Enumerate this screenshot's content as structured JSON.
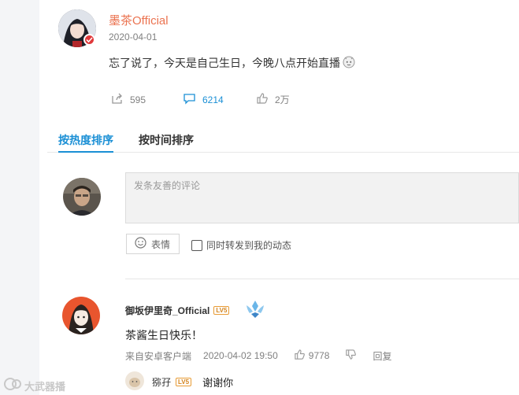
{
  "post": {
    "username": "墨茶Official",
    "date": "2020-04-01",
    "text": "忘了说了，今天是自己生日，今晚八点开始直播",
    "actions": {
      "repost": "595",
      "comment": "6214",
      "like": "2万"
    }
  },
  "tabs": {
    "hot": "按热度排序",
    "time": "按时间排序"
  },
  "composer": {
    "placeholder": "发条友善的评论",
    "emoji_label": "表情",
    "repost_checkbox_label": "同时转发到我的动态"
  },
  "comment": {
    "username": "御坂伊里奇_Official",
    "level": "LV5",
    "text": "茶酱生日快乐！",
    "source": "来自安卓客户端",
    "datetime": "2020-04-02 19:50",
    "likes": "9778",
    "reply_label": "回复"
  },
  "reply": {
    "username": "猕孖",
    "level": "LV5",
    "text": "谢谢你"
  },
  "watermark": "大武器播",
  "colors": {
    "accent": "#1a8fd5",
    "username": "#eb7350",
    "level_badge": "#e89b34"
  }
}
